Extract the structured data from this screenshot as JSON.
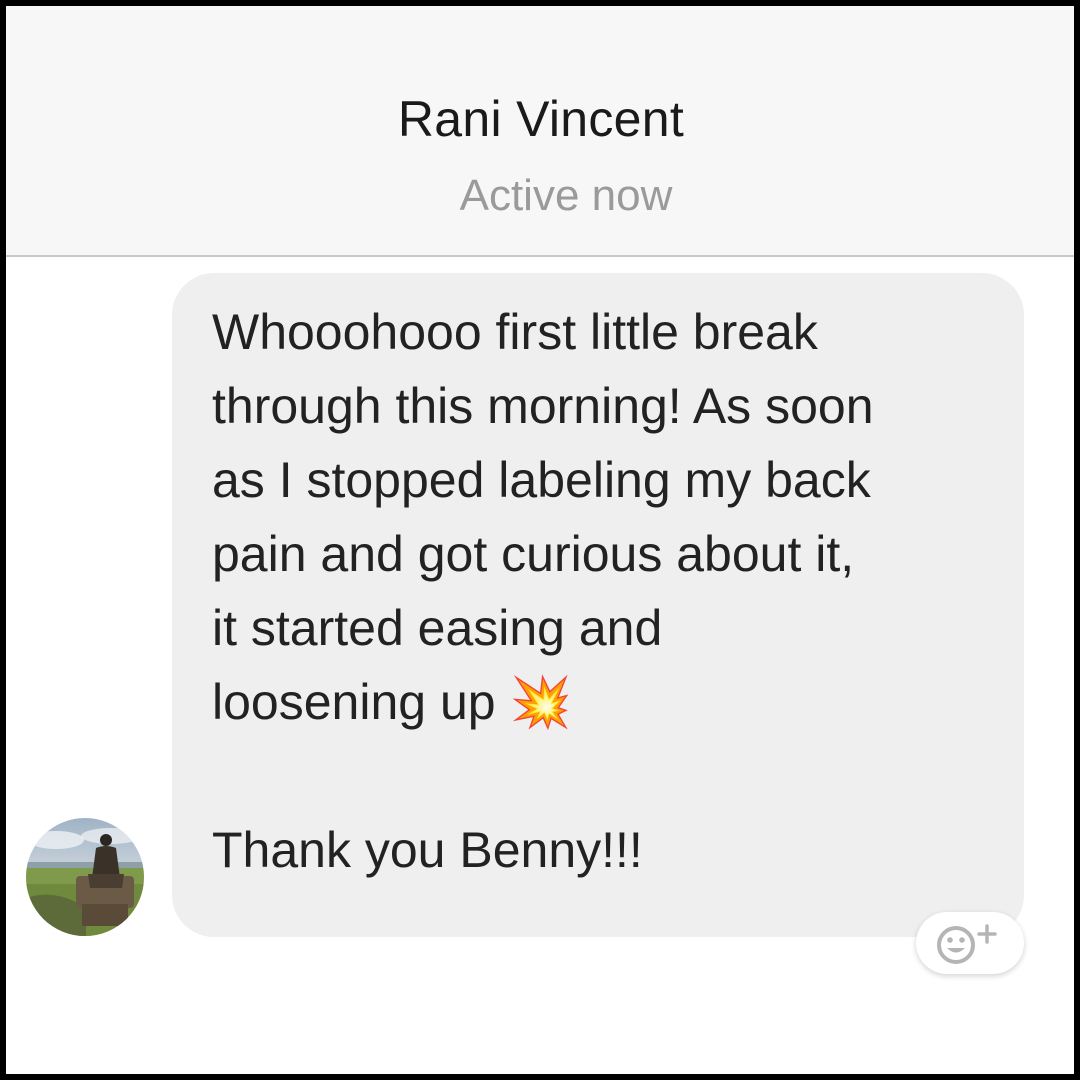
{
  "header": {
    "contact_name": "Rani Vincent",
    "status": "Active now"
  },
  "message": {
    "text": "Whooohooo first little break\nthrough this morning! As soon\nas I stopped labeling my back\npain and got curious about it,\nit started easing and\nloosening up 💥\n\nThank you Benny!!!"
  },
  "reaction_button": {
    "icon": "smiley-plus-icon"
  },
  "avatar": {
    "icon": "contact-avatar"
  },
  "colors": {
    "bubble": "#efefef",
    "header_bg": "#f7f7f7",
    "status_text": "#9a9a9a",
    "frame_border": "#000000"
  }
}
